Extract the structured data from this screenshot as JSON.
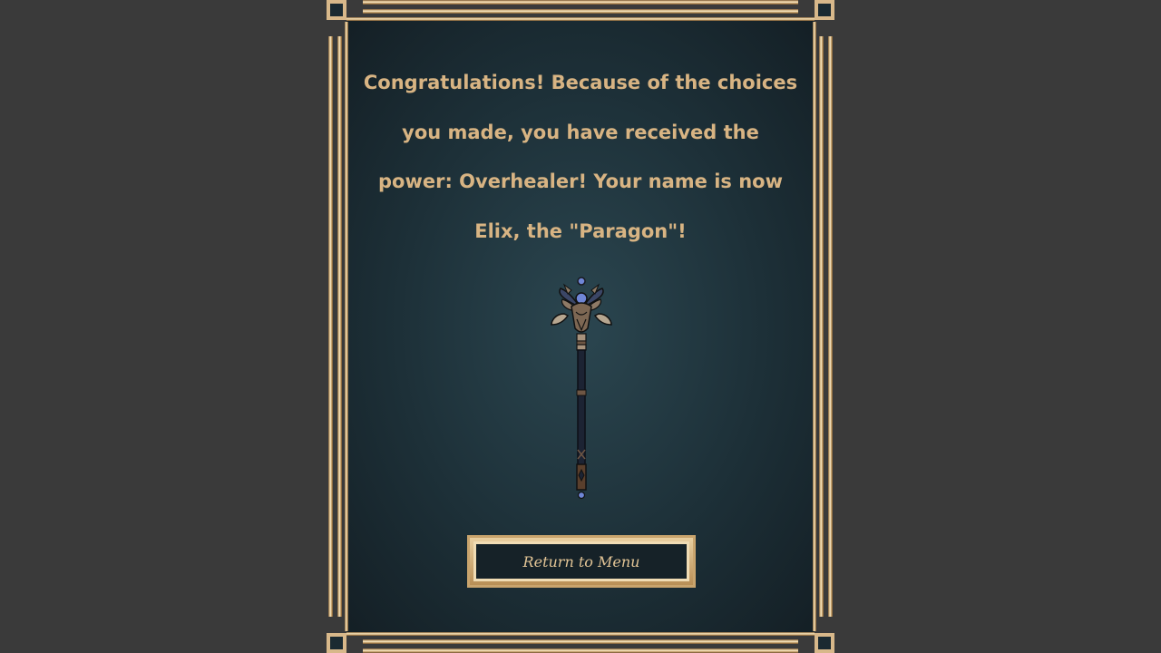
{
  "result": {
    "message": "Congratulations! Because of the choices you made, you have received the power: Overhealer! Your name is now Elix, the \"Paragon\"!"
  },
  "reward_item": {
    "icon": "healer-staff-icon"
  },
  "actions": {
    "return_label": "Return to Menu"
  },
  "colors": {
    "background": "#3a3a3a",
    "panel": "#1d3038",
    "gold": "#d8b483",
    "orb": "#6f86d6"
  }
}
